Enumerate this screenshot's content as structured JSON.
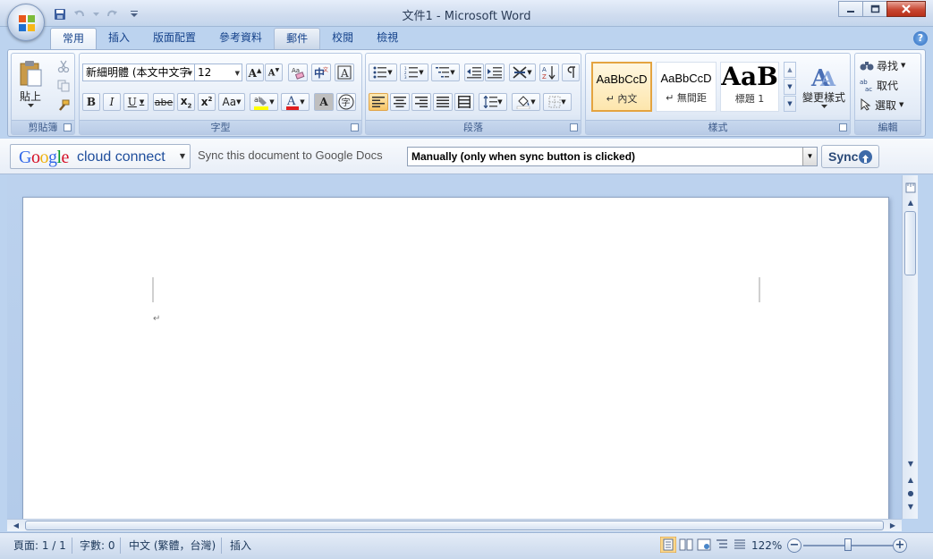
{
  "window": {
    "title": "文件1 - Microsoft Word"
  },
  "tabs": [
    {
      "label": "常用",
      "active": true
    },
    {
      "label": "插入"
    },
    {
      "label": "版面配置"
    },
    {
      "label": "參考資料"
    },
    {
      "label": "郵件"
    },
    {
      "label": "校閱"
    },
    {
      "label": "檢視"
    }
  ],
  "ribbon": {
    "clipboard": {
      "label": "剪貼簿",
      "paste": "貼上"
    },
    "font": {
      "label": "字型",
      "font_name": "新細明體 (本文中文字",
      "font_size": "12",
      "change_case": "Aa"
    },
    "paragraph": {
      "label": "段落"
    },
    "styles": {
      "label": "樣式",
      "tiles": [
        {
          "sample": "AaBbCcD",
          "name": "↵ 內文",
          "selected": true
        },
        {
          "sample": "AaBbCcD",
          "name": "↵ 無間距"
        },
        {
          "sample": "AaB",
          "name": "標題 1"
        }
      ],
      "change_styles": "變更樣式"
    },
    "editing": {
      "label": "編輯",
      "find": "尋找",
      "replace": "取代",
      "select": "選取"
    }
  },
  "google_bar": {
    "brand_google": [
      "G",
      "o",
      "o",
      "g",
      "l",
      "e"
    ],
    "brand_rest": "cloud connect",
    "sync_text": "Sync this document to Google Docs",
    "sync_mode": "Manually (only when sync button is clicked)",
    "sync_button": "Sync"
  },
  "document": {
    "paragraph_mark": "↵"
  },
  "status": {
    "page": "頁面: 1 / 1",
    "words": "字數: 0",
    "language": "中文 (繁體，台灣)",
    "mode": "插入",
    "zoom": "122%"
  },
  "colors": {
    "google_blue": "#3369e8",
    "google_red": "#d50f25",
    "google_yellow": "#eeb211",
    "google_green": "#009925",
    "accent": "#15428b"
  }
}
